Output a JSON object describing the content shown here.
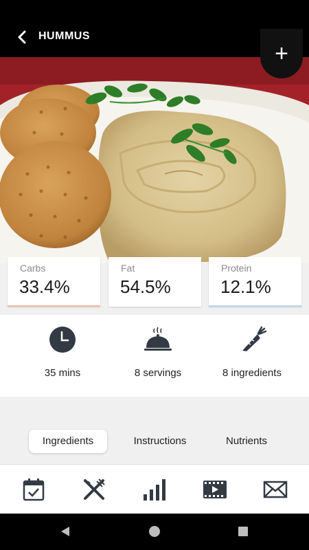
{
  "header": {
    "title": "HUMMUS",
    "add_symbol": "+"
  },
  "macros": [
    {
      "label": "Carbs",
      "value": "33.4%",
      "color": "#f4b8a6"
    },
    {
      "label": "Fat",
      "value": "54.5%",
      "color": "#ffffff"
    },
    {
      "label": "Protein",
      "value": "12.1%",
      "color": "#b9d7f0"
    }
  ],
  "info": [
    {
      "icon": "clock-icon",
      "text": "35 mins"
    },
    {
      "icon": "serving-dish-icon",
      "text": "8 servings"
    },
    {
      "icon": "carrot-icon",
      "text": "8 ingredients"
    }
  ],
  "tabs": [
    "Ingredients",
    "Instructions",
    "Nutrients"
  ],
  "bottom_nav": [
    "calendar-check-icon",
    "fork-knife-icon",
    "bar-chart-icon",
    "film-icon",
    "envelope-icon"
  ],
  "colors": {
    "header": "#000000",
    "icons": "#333a44",
    "background": "#f0f0f0"
  }
}
